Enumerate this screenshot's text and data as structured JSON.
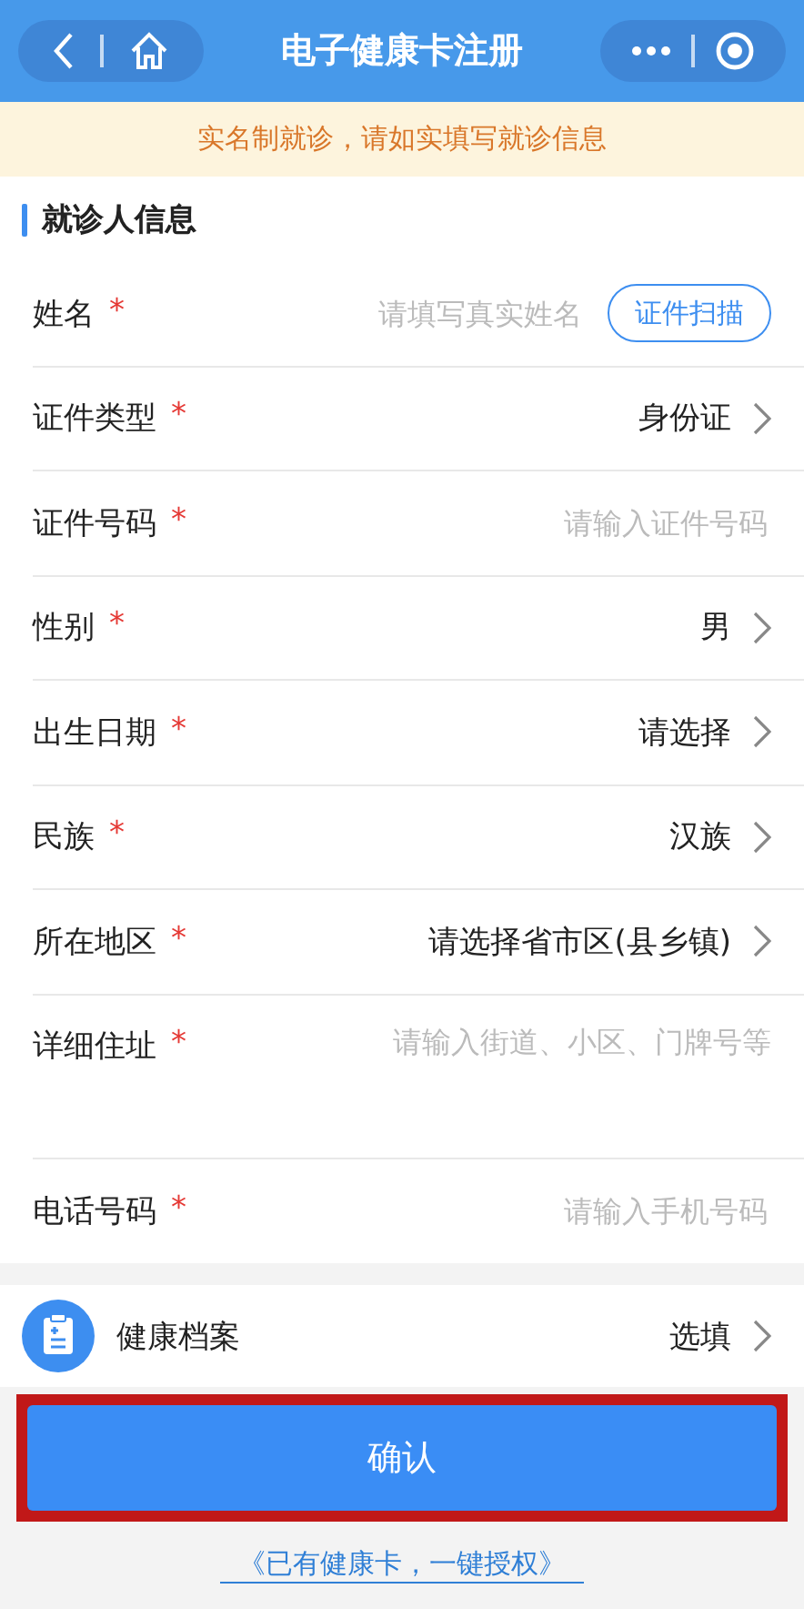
{
  "nav": {
    "title": "电子健康卡注册"
  },
  "notice": "实名制就诊，请如实填写就诊信息",
  "section_title": "就诊人信息",
  "fields": [
    {
      "kind": "input",
      "label": "姓名",
      "required_mark": "*",
      "placeholder": "请填写真实姓名",
      "action": "证件扫描"
    },
    {
      "kind": "select",
      "label": "证件类型",
      "required_mark": "*",
      "value": "身份证"
    },
    {
      "kind": "input",
      "label": "证件号码",
      "required_mark": "*",
      "placeholder": "请输入证件号码"
    },
    {
      "kind": "select",
      "label": "性别",
      "required_mark": "*",
      "value": "男"
    },
    {
      "kind": "select",
      "label": "出生日期",
      "required_mark": "*",
      "value": "请选择"
    },
    {
      "kind": "select",
      "label": "民族",
      "required_mark": "*",
      "value": "汉族"
    },
    {
      "kind": "select",
      "label": "所在地区",
      "required_mark": "*",
      "value": "请选择省市区(县乡镇)"
    },
    {
      "kind": "textarea",
      "label": "详细住址",
      "required_mark": "*",
      "placeholder": "请输入街道、小区、门牌号等"
    },
    {
      "kind": "input",
      "label": "电话号码",
      "required_mark": "*",
      "placeholder": "请输入手机号码"
    }
  ],
  "health_record": {
    "label": "健康档案",
    "value": "选填"
  },
  "confirm": {
    "label": "确认",
    "highlighted": true
  },
  "auth_link": "《已有健康卡，一键授权》"
}
